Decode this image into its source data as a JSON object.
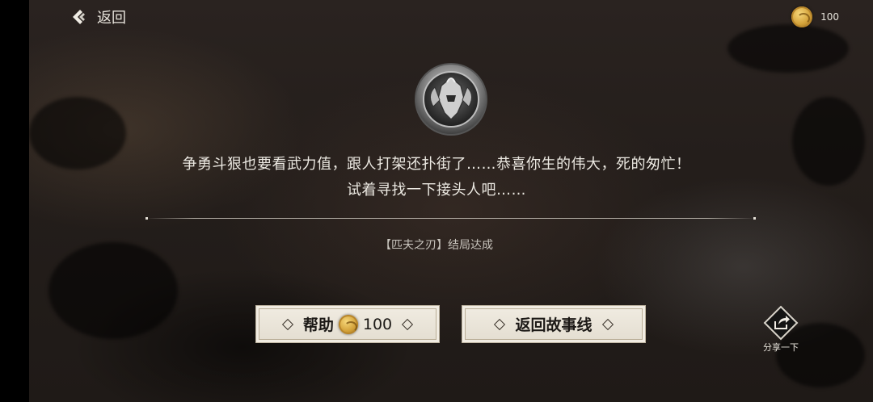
{
  "header": {
    "back_label": "返回",
    "currency_amount": "100"
  },
  "result": {
    "message_line1": "争勇斗狠也要看武力值，跟人打架还扑街了……恭喜你生的伟大，死的匆忙！",
    "message_line2": "试着寻找一下接头人吧……",
    "ending_text": "【匹夫之刃】结局达成"
  },
  "buttons": {
    "help_label": "帮助",
    "help_cost": "100",
    "return_label": "返回故事线"
  },
  "share": {
    "label": "分享一下"
  },
  "colors": {
    "button_bg": "#ebe6da",
    "text_light": "#ece9e2",
    "coin_gold": "#d3a23a"
  },
  "icons": [
    "back-chevron-icon",
    "gold-coin-icon",
    "helmet-emblem-icon",
    "share-icon"
  ]
}
